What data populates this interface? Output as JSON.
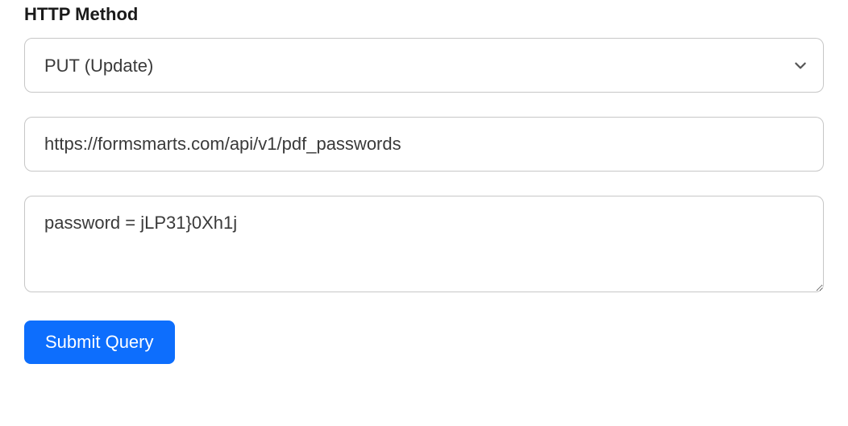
{
  "form": {
    "method_label": "HTTP Method",
    "method_selected": "PUT (Update)",
    "url_value": "https://formsmarts.com/api/v1/pdf_passwords",
    "body_value": "password = jLP31}0Xh1j",
    "submit_label": "Submit Query"
  }
}
